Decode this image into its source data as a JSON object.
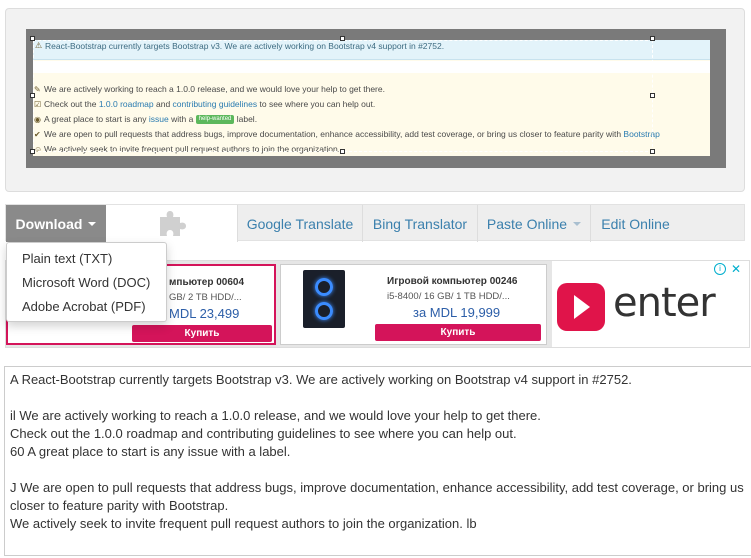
{
  "preview": {
    "alert_text": "React-Bootstrap currently targets Bootstrap v3. We are actively working on Bootstrap v4 support in #2752.",
    "lines": [
      {
        "icon": "megaphone-icon",
        "glyph": "✎",
        "parts": [
          {
            "text": "We are actively working to reach a 1.0.0 release, and we would love your help to get there."
          }
        ]
      },
      {
        "icon": "checklist-icon",
        "glyph": "☑",
        "parts": [
          {
            "text": "Check out the "
          },
          {
            "text": "1.0.0 roadmap",
            "link": true
          },
          {
            "text": " and "
          },
          {
            "text": "contributing guidelines",
            "link": true
          },
          {
            "text": " to see where you can help out."
          }
        ]
      },
      {
        "icon": "eyes-icon",
        "glyph": "◉",
        "parts": [
          {
            "text": "A great place to start is any "
          },
          {
            "text": "issue",
            "link": true
          },
          {
            "text": " with a "
          },
          {
            "text": "help-wanted",
            "badge": true
          },
          {
            "text": " label."
          }
        ]
      },
      {
        "icon": "checkmark-icon",
        "glyph": "✔",
        "parts": [
          {
            "text": "We are open to pull requests that address bugs, improve documentation, enhance accessibility, add test coverage, or bring us closer to feature parity with "
          },
          {
            "text": "Bootstrap",
            "link": true
          }
        ]
      },
      {
        "icon": "person-icon",
        "glyph": "☺",
        "parts": [
          {
            "text": "We actively seek to invite frequent pull request authors to join the organization. "
          }
        ]
      }
    ]
  },
  "toolbar": {
    "download_label": "Download",
    "google_translate": "Google Translate",
    "bing_translator": "Bing Translator",
    "paste_online": "Paste Online",
    "edit_online": "Edit Online"
  },
  "download_menu": [
    "Plain text (TXT)",
    "Microsoft Word (DOC)",
    "Adobe Acrobat (PDF)"
  ],
  "ads": {
    "card1": {
      "title": "мпьютер 00604",
      "specs": "GB/ 2 TB HDD/...",
      "price": "MDL 23,499",
      "buy": "Купить"
    },
    "card2": {
      "title": "Игровой компьютер 00246",
      "specs": "i5-8400/ 16 GB/ 1 TB HDD/...",
      "price": "за MDL 19,999",
      "buy": "Купить"
    },
    "enter_text": "enter",
    "info_glyph": "i",
    "close_glyph": "✕"
  },
  "output_lines": [
    "A React-Bootstrap currently targets Bootstrap v3. We are actively working on Bootstrap v4 support in #2752.",
    "",
    "il We are actively working to reach a 1.0.0 release, and we would love your help to get there.",
    "Check out the 1.0.0 roadmap and contributing guidelines to see where you can help out.",
    "60 A great place to start is any issue with a label.",
    "",
    "J We are open to pull requests that address bugs, improve documentation, enhance accessibility, add test coverage, or bring us closer to feature parity with Bootstrap.",
    "We actively seek to invite frequent pull request authors to join the organization. lb"
  ],
  "colors": {
    "accent": "#3b80ad",
    "download_bg": "#8a8a8a",
    "ad_red": "#d4145a",
    "alert_bg": "#e3f3fa"
  }
}
